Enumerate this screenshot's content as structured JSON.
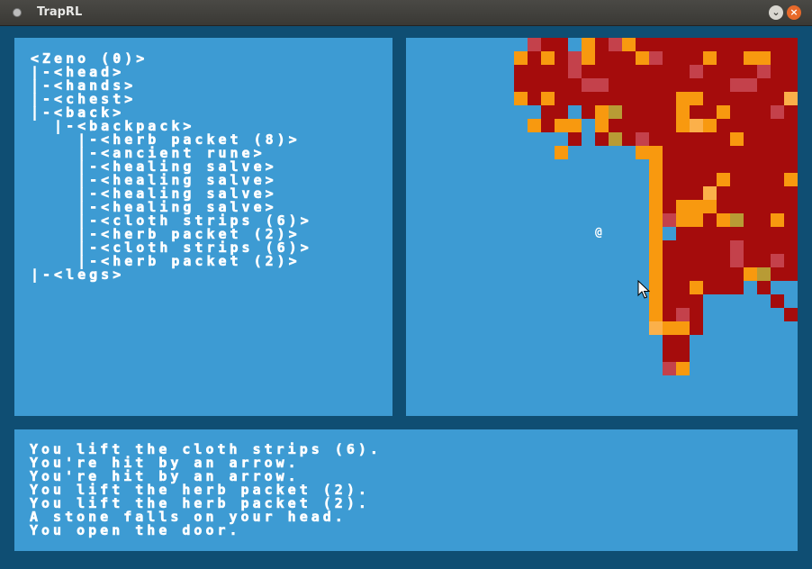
{
  "window": {
    "title": "TrapRL"
  },
  "inventory": {
    "lines": [
      "<Zeno (0)>",
      "|-<head>",
      "|-<hands>",
      "|-<chest>",
      "|-<back>",
      "  |-<backpack>",
      "    |-<herb packet (8)>",
      "    |-<ancient rune>",
      "    |-<healing salve>",
      "    |-<healing salve>",
      "    |-<healing salve>",
      "    |-<healing salve>",
      "    |-<cloth strips (6)>",
      "    |-<herb packet (2)>",
      "    |-<cloth strips (6)>",
      "    |-<herb packet (2)>",
      "|-<legs>"
    ]
  },
  "message_log": {
    "lines": [
      "You lift the cloth strips (6).",
      "You're hit by an arrow.",
      "You're hit by an arrow.",
      "You lift the herb packet (2).",
      "You lift the herb packet (2).",
      "A stone falls on your head.",
      "You open the door."
    ]
  },
  "map": {
    "player_glyph": "@",
    "colors": {
      "background": "#3d9bd3",
      "dark_red": "#a50c0c",
      "orange": "#f8990f",
      "pink": "#c4414b",
      "olive": "#b89b35",
      "light_orange": "#fbb04a"
    }
  }
}
